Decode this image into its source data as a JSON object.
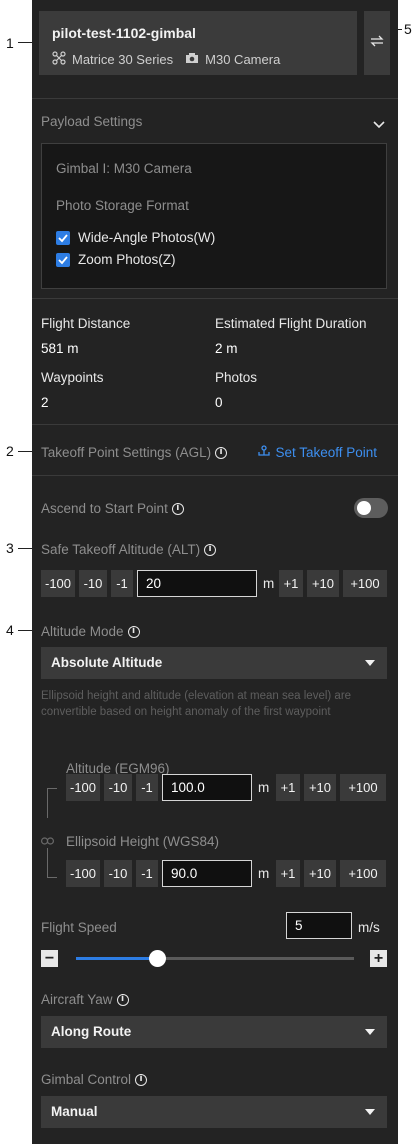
{
  "callouts": [
    "1",
    "2",
    "3",
    "4",
    "5"
  ],
  "header": {
    "title": "pilot-test-1102-gimbal",
    "aircraft": "Matrice 30 Series",
    "camera": "M30 Camera"
  },
  "payload": {
    "section_title": "Payload Settings",
    "gimbal": "Gimbal I: M30 Camera",
    "storage_label": "Photo Storage Format",
    "options": [
      {
        "label": "Wide-Angle Photos(W)",
        "checked": true
      },
      {
        "label": "Zoom Photos(Z)",
        "checked": true
      }
    ]
  },
  "stats": {
    "distance_label": "Flight Distance",
    "distance_value": "581 m",
    "duration_label": "Estimated Flight Duration",
    "duration_value": "2 m",
    "waypoints_label": "Waypoints",
    "waypoints_value": "2",
    "photos_label": "Photos",
    "photos_value": "0"
  },
  "takeoff": {
    "label": "Takeoff Point Settings (AGL)",
    "set_link": "Set Takeoff Point"
  },
  "ascend": {
    "label": "Ascend to Start Point",
    "enabled": false
  },
  "safe_takeoff": {
    "label": "Safe Takeoff Altitude (ALT)",
    "value": "20",
    "unit": "m"
  },
  "step_buttons": {
    "m100": "-100",
    "m10": "-10",
    "m1": "-1",
    "p1": "+1",
    "p10": "+10",
    "p100": "+100"
  },
  "altitude_mode": {
    "label": "Altitude Mode",
    "selected": "Absolute Altitude",
    "help": "Ellipsoid height and altitude (elevation at mean sea level) are convertible based on height anomaly of the first waypoint"
  },
  "altitude_egm": {
    "label": "Altitude (EGM96)",
    "value": "100.0",
    "unit": "m"
  },
  "ellipsoid": {
    "label": "Ellipsoid Height (WGS84)",
    "value": "90.0",
    "unit": "m"
  },
  "speed": {
    "label": "Flight Speed",
    "value": "5",
    "unit": "m/s",
    "slider_fraction": 0.29
  },
  "yaw": {
    "label": "Aircraft Yaw",
    "selected": "Along Route"
  },
  "gimbal_control": {
    "label": "Gimbal Control",
    "selected": "Manual"
  },
  "colors": {
    "panel": "#232323",
    "accent": "#2d7de4",
    "link": "#3d8ff0"
  },
  "icons": [
    "drone-icon",
    "camera-icon",
    "swap-icon",
    "chevron-up-icon",
    "check-icon",
    "info-icon",
    "takeoff-point-icon",
    "link-icon",
    "minus-icon",
    "plus-icon",
    "caret-down-icon"
  ]
}
